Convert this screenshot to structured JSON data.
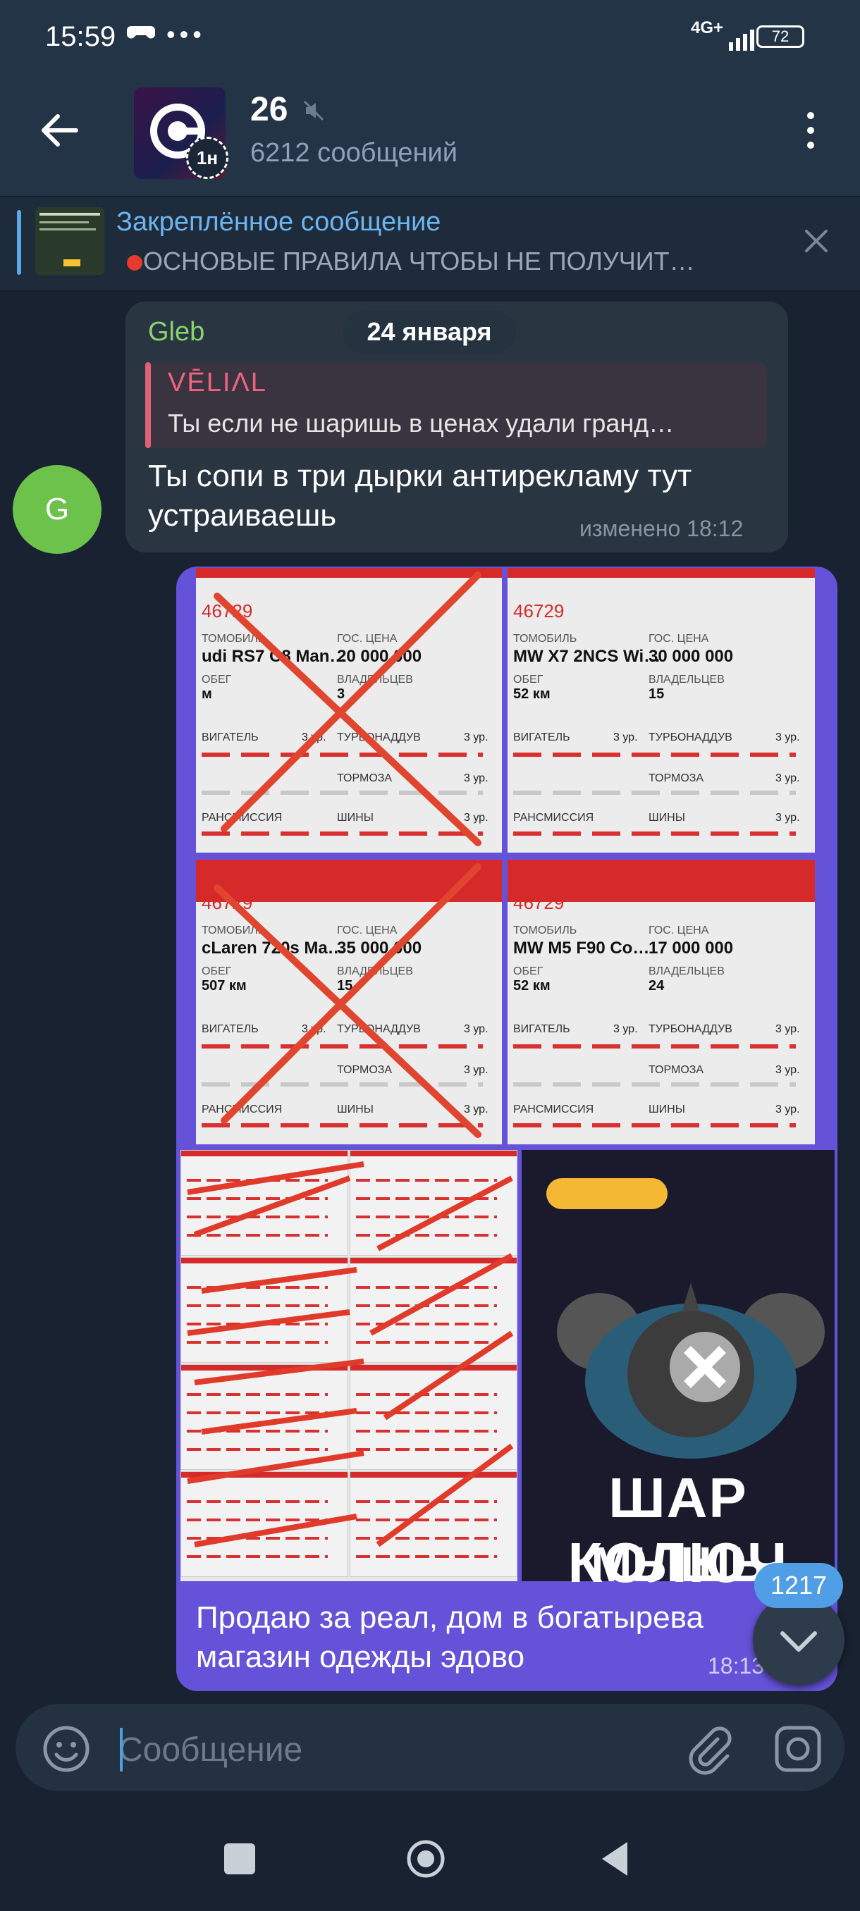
{
  "status": {
    "time": "15:59",
    "network": "4G+",
    "battery": "72",
    "extra_icons": "•••"
  },
  "header": {
    "title": "26",
    "subtitle": "6212 сообщений",
    "avatar_badge": "1н"
  },
  "pinned": {
    "title": "Закреплённое сообщение",
    "text": "ОСНОВЫЕ ПРАВИЛА ЧТОБЫ НЕ ПОЛУЧИТ…"
  },
  "date_chip": "24 января",
  "message1": {
    "sender": "Gleb",
    "avatar_letter": "G",
    "reply_name": "VĒLIΛL",
    "reply_text": "Ты если не шаришь в ценах удали гранд…",
    "text": "Ты сопи в три дырки антирекламу тут устраиваешь",
    "time": "изменено 18:12"
  },
  "message2": {
    "text": "Продаю за реал, дом в богатырева магазин одежды эдово",
    "time": "18:13",
    "photos": [
      {
        "id": "46729",
        "car": "udi RS7 C8 Man…",
        "price": "20 000 000",
        "owners": "3",
        "mileage": "м"
      },
      {
        "id": "46729",
        "car": "MW X7 2NCS Wi…",
        "price": "30 000 000",
        "owners": "15",
        "mileage": "52 км"
      },
      {
        "id": "46729",
        "car": "cLaren 720s Ma…",
        "price": "35 000 000",
        "owners": "15",
        "mileage": "507 км"
      },
      {
        "id": "46729",
        "car": "MW M5 F90 Co…",
        "price": "17 000 000",
        "owners": "24",
        "mileage": "52 км"
      }
    ],
    "labels": {
      "car": "ТОМОБИЛЬ",
      "gov_price": "ГОС. ЦЕНА",
      "mileage": "ОБЕГ",
      "owners": "ВЛАДЕЛЬЦЕВ",
      "engine": "ВИГАТЕЛЬ",
      "turbo": "ТУРБОНАДДУВ",
      "brakes": "ТОРМОЗА",
      "tires": "ШИНЫ",
      "trans": "РАНСМИССИЯ",
      "level": "3 ур."
    },
    "sticker_text": "ШАР КОЛЮЧ",
    "sticker_text2": "МЫШЬ"
  },
  "unread_count": "1217",
  "input": {
    "placeholder": "Сообщение"
  }
}
